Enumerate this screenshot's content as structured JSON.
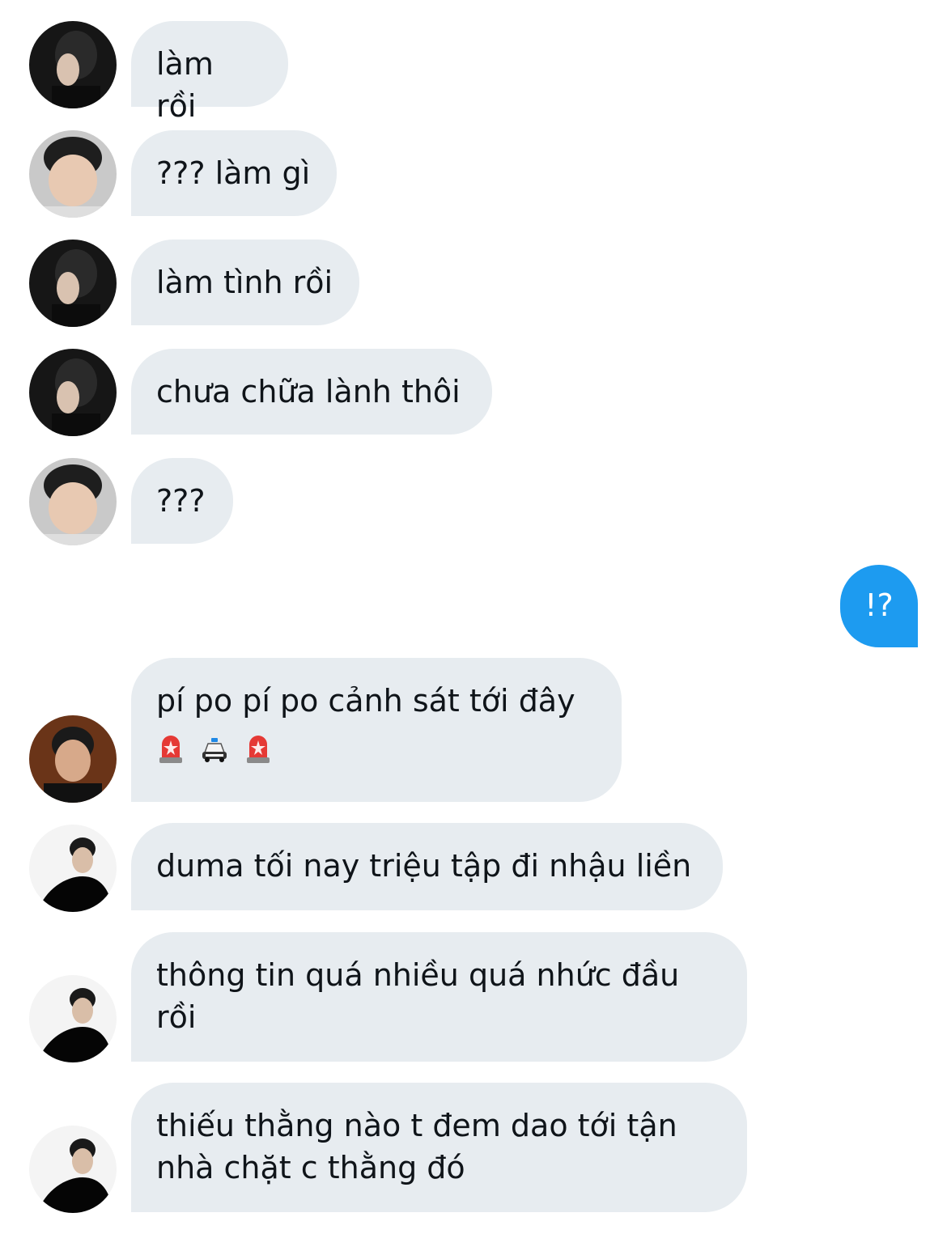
{
  "colors": {
    "incoming_bubble": "#e7ecf0",
    "outgoing_bubble": "#1d9bf0",
    "text": "#0f1419"
  },
  "messages": [
    {
      "sender": "user-a",
      "text": "làm rồi"
    },
    {
      "sender": "user-b",
      "text": "??? làm gì"
    },
    {
      "sender": "user-a",
      "text": "làm tình rồi"
    },
    {
      "sender": "user-a",
      "text": "chưa chữa lành thôi"
    },
    {
      "sender": "user-b",
      "text": "???"
    },
    {
      "sender": "self",
      "text": "!?"
    },
    {
      "sender": "user-c",
      "text": "pí po pí po cảnh sát tới đây",
      "emoji": [
        "police-light-icon",
        "police-car-icon",
        "police-light-icon"
      ]
    },
    {
      "sender": "user-d",
      "text": "duma tối nay triệu tập đi nhậu liền"
    },
    {
      "sender": "user-d",
      "text": "thông tin quá nhiều quá nhức đầu rồi"
    },
    {
      "sender": "user-d",
      "text": "thiếu thằng nào t đem dao tới tận nhà chặt c thằng đó"
    }
  ]
}
